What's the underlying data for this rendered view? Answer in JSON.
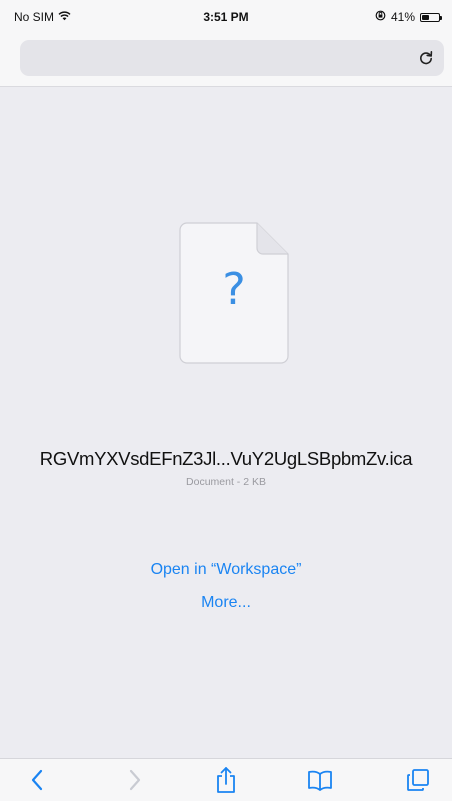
{
  "status_bar": {
    "carrier": "No SIM",
    "time": "3:51 PM",
    "battery_percent_label": "41%",
    "battery_level": 0.41
  },
  "address_bar": {
    "reload_icon": "reload-icon"
  },
  "document": {
    "file_name": "RGVmYXVsdEFnZ3Jl...VuY2UgLSBpbmZv.ica",
    "meta": "Document - 2 KB",
    "placeholder_glyph": "?"
  },
  "actions": {
    "open_in": "Open in “Workspace”",
    "more": "More..."
  },
  "toolbar": {
    "icons": [
      "back-icon",
      "forward-icon",
      "share-icon",
      "bookmarks-icon",
      "tabs-icon"
    ]
  },
  "colors": {
    "accent": "#1a84f2",
    "background": "#ececf1",
    "chrome": "#f7f7f8"
  }
}
